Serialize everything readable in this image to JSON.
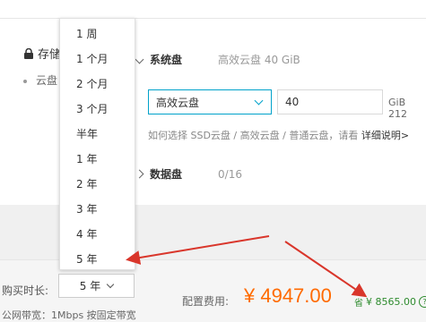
{
  "storage": {
    "title": "存储",
    "bullet": "云盘"
  },
  "system_disk": {
    "name": "系统盘",
    "meta": "高效云盘 40 GiB",
    "type_value": "高效云盘",
    "size_value": "40",
    "unit": "GiB 212"
  },
  "help": {
    "text": "如何选择 SSD云盘 / 高效云盘 / 普通云盘，请看",
    "link": "详细说明>"
  },
  "data_disk": {
    "name": "数据盘",
    "meta": "0/16"
  },
  "dropdown_options": [
    "1 周",
    "1 个月",
    "2 个月",
    "3 个月",
    "半年",
    "1 年",
    "2 年",
    "3 年",
    "4 年",
    "5 年"
  ],
  "purchase": {
    "label": "购买时长:",
    "selected": "5 年"
  },
  "bandwidth": "公网带宽：1Mbps 按固定带宽",
  "fee": {
    "label": "配置费用:",
    "price": "¥ 4947.00",
    "saving_tag": "省",
    "saving": "¥ 8565.00"
  },
  "colors": {
    "accent": "#00a2ca",
    "price": "#ff6a00",
    "saving": "#2e8b2e",
    "annotation": "#d9362b"
  }
}
